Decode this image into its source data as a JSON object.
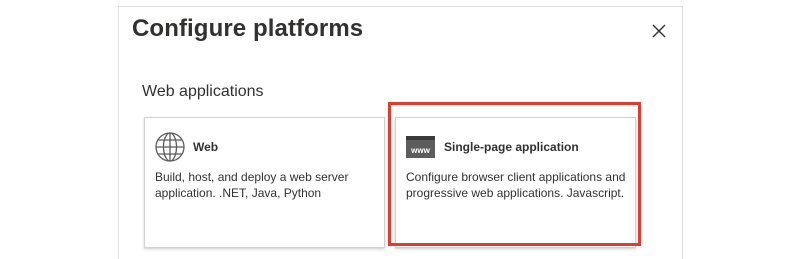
{
  "panel": {
    "title": "Configure platforms",
    "close_icon": "close-icon"
  },
  "section": {
    "label": "Web applications"
  },
  "cards": [
    {
      "icon": "globe-icon",
      "title": "Web",
      "description": "Build, host, and deploy a web server application. .NET, Java, Python"
    },
    {
      "icon": "www-window-icon",
      "icon_text": "www",
      "title": "Single-page application",
      "description": "Configure browser client applications and progressive web applications. Javascript."
    }
  ],
  "colors": {
    "highlight": "#e23b2e",
    "text": "#323130",
    "icon_dark": "#5c5c5c"
  }
}
